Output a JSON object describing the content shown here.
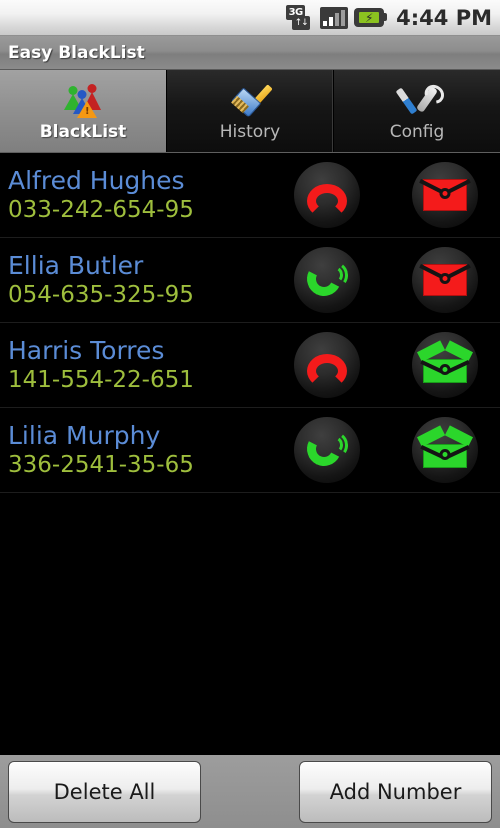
{
  "statusbar": {
    "network_label": "3G",
    "network_arrows": "↑↓",
    "battery_bolt": "⚡",
    "time": "4:44 PM"
  },
  "titlebar": {
    "title": "Easy BlackList"
  },
  "tabs": [
    {
      "label": "BlackList",
      "icon": "blacklist-people-warning-icon",
      "active": true
    },
    {
      "label": "History",
      "icon": "broom-icon",
      "active": false
    },
    {
      "label": "Config",
      "icon": "tools-icon",
      "active": false
    }
  ],
  "list": {
    "rows": [
      {
        "name": "Alfred Hughes",
        "number": "033-242-654-95",
        "call_icon": "call-blocked-icon",
        "call_state": "blocked",
        "sms_icon": "sms-blocked-icon",
        "sms_state": "blocked"
      },
      {
        "name": "Ellia Butler",
        "number": "054-635-325-95",
        "call_icon": "call-allowed-icon",
        "call_state": "allowed",
        "sms_icon": "sms-blocked-icon",
        "sms_state": "blocked"
      },
      {
        "name": "Harris Torres",
        "number": "141-554-22-651",
        "call_icon": "call-blocked-icon",
        "call_state": "blocked",
        "sms_icon": "sms-allowed-icon",
        "sms_state": "allowed"
      },
      {
        "name": "Lilia Murphy",
        "number": "336-2541-35-65",
        "call_icon": "call-allowed-icon",
        "call_state": "allowed",
        "sms_icon": "sms-allowed-icon",
        "sms_state": "allowed"
      }
    ]
  },
  "bottombar": {
    "delete_all_label": "Delete All",
    "add_number_label": "Add Number"
  },
  "colors": {
    "name_blue": "#5b8cd6",
    "number_green": "#9ebe3d",
    "blocked_red": "#f41b1b",
    "allowed_green": "#2bd62b",
    "battery_green": "#8bc220"
  }
}
